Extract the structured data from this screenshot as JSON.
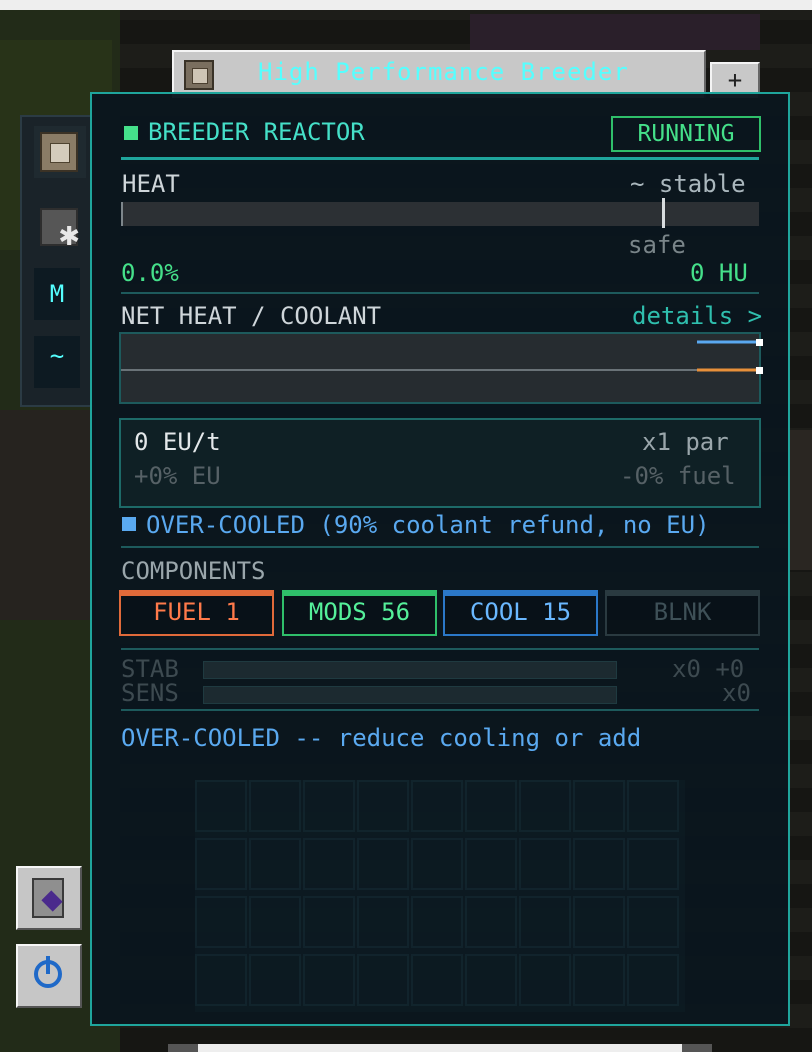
{
  "window": {
    "title": "High Performance Breeder",
    "add_tab_label": "+"
  },
  "side_tabs": [
    {
      "name": "reactor",
      "icon": "reactor-block-icon"
    },
    {
      "name": "config",
      "icon": "gear-block-icon"
    },
    {
      "name": "M",
      "label": "M"
    },
    {
      "name": "wave",
      "label": "~"
    }
  ],
  "panel": {
    "header": {
      "title": "BREEDER REACTOR",
      "status": "RUNNING"
    },
    "heat": {
      "label": "HEAT",
      "trend": "~ stable",
      "safe_label": "safe",
      "percent": "0.0%",
      "value": "0 HU",
      "fill_fraction": 0.0,
      "safe_fraction": 0.85
    },
    "net": {
      "label": "NET HEAT / COOLANT",
      "details_link": "details >"
    },
    "output": {
      "eu": "0 EU/t",
      "parallel": "x1 par",
      "eu_bonus": "+0% EU",
      "fuel_mod": "-0% fuel"
    },
    "overcooled": "OVER-COOLED  (90% coolant refund, no EU)",
    "components": {
      "label": "COMPONENTS",
      "buttons": [
        {
          "label": "FUEL 1",
          "color": "#e06a3a",
          "text_color": "#ff7a4a"
        },
        {
          "label": "MODS 56",
          "color": "#2fbf6a",
          "text_color": "#55f09a"
        },
        {
          "label": "COOL 15",
          "color": "#2b78c8",
          "text_color": "#6ab8ff"
        },
        {
          "label": "BLNK",
          "color": "#2a3a40",
          "text_color": "#3e5057"
        }
      ]
    },
    "stab": {
      "label": "STAB",
      "value": "x0 +0"
    },
    "sens": {
      "label": "SENS",
      "value": "x0"
    },
    "message": "OVER-COOLED -- reduce cooling or add"
  },
  "colors": {
    "accent": "#1fa59c",
    "running": "#45e08a",
    "info": "#5aa9f0",
    "heat_line": "#5aa9f0",
    "coolant_line": "#e8903a"
  }
}
